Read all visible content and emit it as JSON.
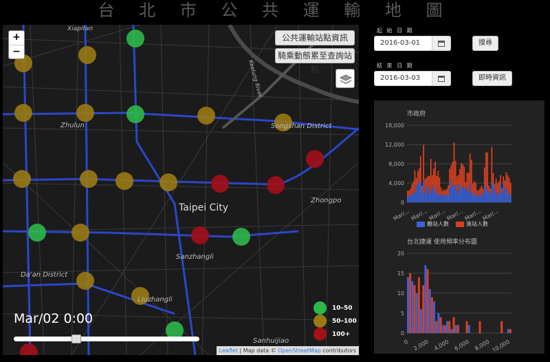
{
  "title": "台 北 市 公 共 運 輸 地 圖",
  "map": {
    "zoom_in": "+",
    "zoom_out": "−",
    "button_transit_info": "公共運輸站點資訊",
    "button_bike_station": "騎乘動態累至查詢站點",
    "time_label": "Mar/02 0:00",
    "slider_value": 0.33,
    "legend": [
      {
        "label": "10–50",
        "color": "#2db84a"
      },
      {
        "label": "50–100",
        "color": "#9a7a14"
      },
      {
        "label": "100+",
        "color": "#a3101a"
      }
    ],
    "attribution_leaflet": "Leaflet",
    "attribution_text": " | Map data © ",
    "attribution_osm": "OpenStreetMap",
    "attribution_tail": " contributors",
    "place_labels": {
      "xiapitan": "Xiapitan",
      "zhulun": "Zhulun",
      "songshan": "Songshan District",
      "taipei": "Taipei City",
      "zhongpo": "Zhongpo",
      "sanzhangli": "Sanzhangli",
      "liuzhangli": "Liuzhangli",
      "daan": "Da'an District",
      "sanhuijiao": "Sanhuijiao",
      "keelung_river": "Keelung River"
    }
  },
  "sidebar": {
    "start_label": "起 始 日 期",
    "start_value": "2016-03-01",
    "end_label": "結 束 日 期",
    "end_value": "2016-03-03",
    "search_button": "搜尋",
    "realtime_button": "即時資訊"
  },
  "chart_data": [
    {
      "type": "bar",
      "title": "市政府",
      "ylim": [
        0,
        18000
      ],
      "yticks": [
        "18,000",
        "12,000",
        "8,000",
        "4,000",
        "0"
      ],
      "xtick_label": "Mar/...",
      "series": [
        {
          "name": "離站人數",
          "color": "#3a62d8"
        },
        {
          "name": "進站人數",
          "color": "#d84020"
        }
      ]
    },
    {
      "type": "bar",
      "title": "台北捷運 使用頻率分布圖",
      "ylim": [
        0,
        20
      ],
      "yticks": [
        "20",
        "15",
        "10",
        "5",
        "0"
      ],
      "xticks": [
        "0",
        "2,000",
        "4,000",
        "6,000",
        "8,000",
        "10,000"
      ],
      "series_colors": [
        "#3a62d8",
        "#d84020"
      ]
    }
  ]
}
